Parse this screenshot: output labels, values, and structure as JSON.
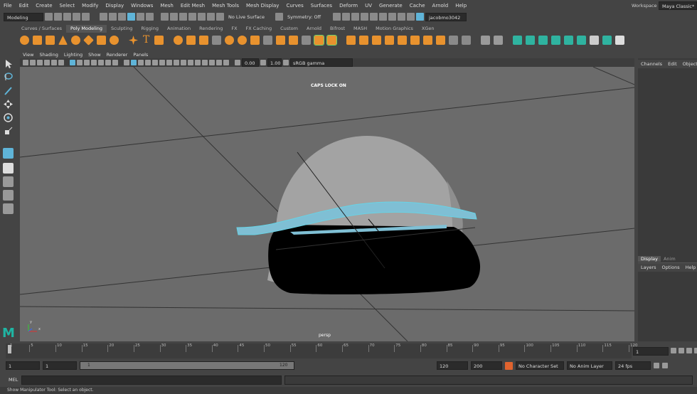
{
  "menubar": {
    "items": [
      "File",
      "Edit",
      "Create",
      "Select",
      "Modify",
      "Display",
      "Windows",
      "Mesh",
      "Edit Mesh",
      "Mesh Tools",
      "Mesh Display",
      "Curves",
      "Surfaces",
      "Deform",
      "UV",
      "Generate",
      "Cache",
      "Arnold",
      "Help"
    ],
    "workspace_label": "Workspace :",
    "workspace_value": "Maya Classic*"
  },
  "statusline": {
    "mode": "Modeling",
    "live_surface": "No Live Surface",
    "symmetry": "Symmetry: Off",
    "user": "jacobmo3042"
  },
  "shelf_tabs": [
    "Curves / Surfaces",
    "Poly Modeling",
    "Sculpting",
    "Rigging",
    "Animation",
    "Rendering",
    "FX",
    "FX Caching",
    "Custom",
    "Arnold",
    "Bifrost",
    "MASH",
    "Motion Graphics",
    "XGen"
  ],
  "active_shelf_tab": "Poly Modeling",
  "viewport": {
    "menu": [
      "View",
      "Shading",
      "Lighting",
      "Show",
      "Renderer",
      "Panels"
    ],
    "exposure": "0.00",
    "gamma": "1.00",
    "color_space": "sRGB gamma",
    "caps_lock": "CAPS LOCK ON",
    "camera": "persp",
    "axis_x": "x",
    "axis_y": "y"
  },
  "channel_box": {
    "tabs": [
      "Channels",
      "Edit",
      "Object"
    ]
  },
  "layer_editor": {
    "tabs": [
      "Display",
      "Anim"
    ],
    "menu": [
      "Layers",
      "Options",
      "Help"
    ]
  },
  "timeline": {
    "ticks": [
      "1",
      "5",
      "10",
      "15",
      "20",
      "25",
      "30",
      "35",
      "40",
      "45",
      "50",
      "55",
      "60",
      "65",
      "70",
      "75",
      "80",
      "85",
      "90",
      "95",
      "100",
      "105",
      "110",
      "115",
      "120"
    ],
    "current_frame": "1"
  },
  "range": {
    "start": "1",
    "anim_start": "1",
    "slider_start": "1",
    "slider_end": "120",
    "end": "120",
    "anim_end": "200",
    "character_set": "No Character Set",
    "anim_layer": "No Anim Layer",
    "fps": "24 fps"
  },
  "command_line": {
    "label": "MEL"
  },
  "help_line": "Show Manipulator Tool: Select an object.",
  "colors": {
    "accent_orange": "#e8922e",
    "shelf_teal": "#2fb3a0",
    "selection_cyan": "#67d3e6",
    "maya_logo": "#1fb5a3"
  }
}
